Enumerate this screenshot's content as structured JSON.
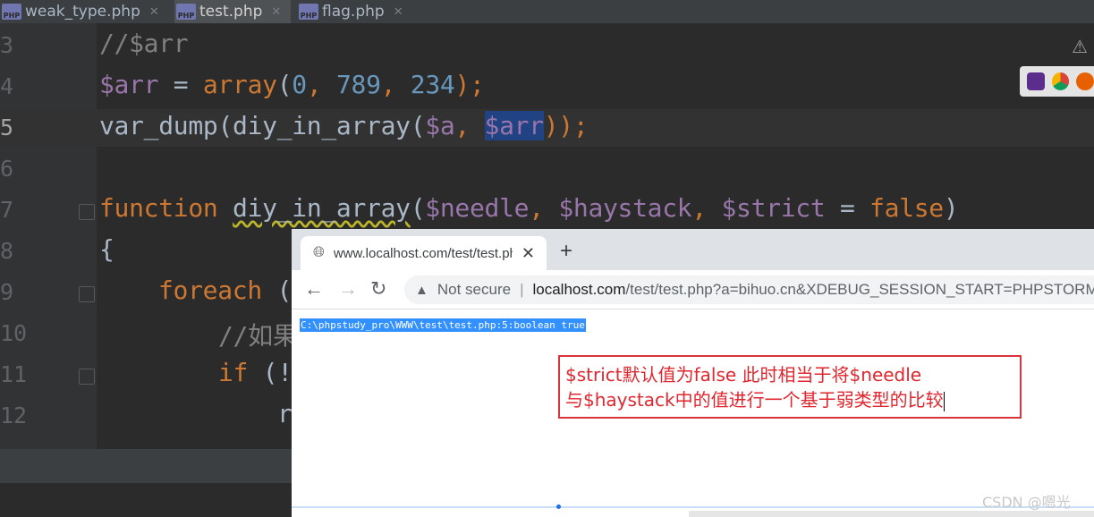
{
  "ide": {
    "tabs": [
      {
        "label": "weak_type.php",
        "icon": "php-file-icon",
        "badge": "PHP"
      },
      {
        "label": "test.php",
        "icon": "php-file-icon",
        "badge": "PHP"
      },
      {
        "label": "flag.php",
        "icon": "php-file-icon",
        "badge": "PHP"
      }
    ],
    "line_numbers": [
      "3",
      "4",
      "5",
      "6",
      "7",
      "8",
      "9",
      "10",
      "11",
      "12"
    ],
    "current_line": "5",
    "code": {
      "l3": "//$arr",
      "l4_var": "$arr",
      "l4_eq": " = ",
      "l4_fn": "array",
      "l4_open": "(",
      "l4_n1": "0",
      "l4_c1": ", ",
      "l4_n2": "789",
      "l4_c2": ", ",
      "l4_n3": "234",
      "l4_close": ");",
      "l5_call": "var_dump(diy_in_array(",
      "l5_a": "$a",
      "l5_comma": ", ",
      "l5_arr": "$arr",
      "l5_end": "));",
      "l7_kw": "function",
      "l7_name": "diy_in_array",
      "l7_open": "(",
      "l7_p1": "$needle",
      "l7_c1": ", ",
      "l7_p2": "$haystack",
      "l7_c2": ", ",
      "l7_p3": "$strict",
      "l7_eq": " = ",
      "l7_false": "false",
      "l7_close": ")",
      "l8": "{",
      "l9_kw": "foreach",
      "l9_rest": " (",
      "l10": "//如果",
      "l11_kw": "if",
      "l11_rest": " (!",
      "l12": "r"
    }
  },
  "browser": {
    "tab_title": "www.localhost.com/test/test.php",
    "new_tab": "+",
    "security_label": "Not secure",
    "url_host": "localhost.com",
    "url_rest": "/test/test.php?a=bihuo.cn&XDEBUG_SESSION_START=PHPSTORM",
    "output": "C:\\phpstudy_pro\\WWW\\test\\test.php:5:boolean true",
    "annotation_line1": "$strict默认值为false 此时相当于将$needle",
    "annotation_line2": "与$haystack中的值进行一个基于弱类型的比较"
  },
  "watermark": "CSDN @嗯光",
  "colors": {
    "accent_annotation": "#d9343b",
    "selection": "#3390ff"
  }
}
